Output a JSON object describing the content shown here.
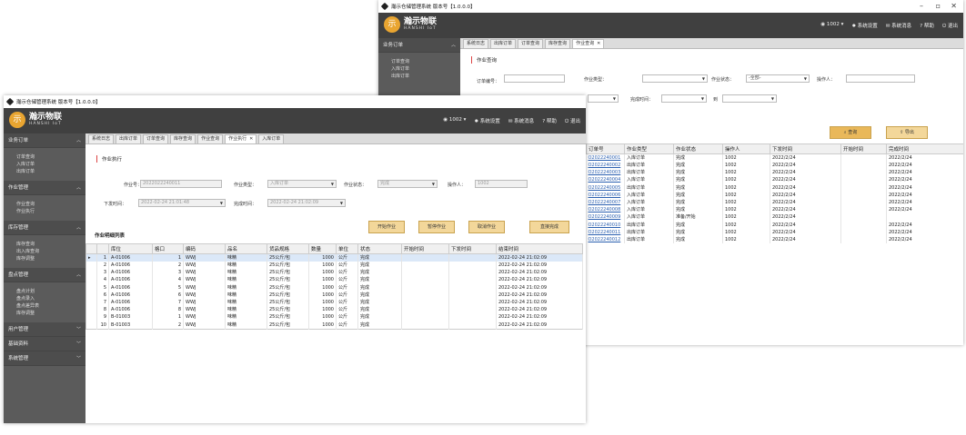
{
  "window_title": "瀚示仓储管理系统 版本号【1.0.0.0】",
  "logo": {
    "char": "示",
    "cn": "瀚示物联",
    "en": "HANSHI IoT"
  },
  "header": {
    "user": "1002",
    "settings": "系统设置",
    "messages": "系统消息",
    "help": "帮助",
    "exit": "退出"
  },
  "controls": {
    "min": "–",
    "max": "▫",
    "close": "✕"
  },
  "back": {
    "sidebar": [
      {
        "group": "业务订单",
        "items": [
          "订单查询",
          "入库订单",
          "出库订单"
        ]
      }
    ],
    "tabs": [
      "系统日志",
      "出库订单",
      "订单查询",
      "库存查询",
      "作业查询"
    ],
    "panel_title": "作业查询",
    "filters": {
      "order_no": "订单编号：",
      "job_type": "作业类型：",
      "job_status": "作业状态：",
      "status_value": "-全部-",
      "operator": "操作人：",
      "finish_time": "完成时间：",
      "to": "到"
    },
    "query": "查询",
    "export": "导出",
    "columns": [
      "订单号",
      "作业类型",
      "作业状态",
      "操作人",
      "下发时间",
      "开始时间",
      "完成时间"
    ],
    "rows": [
      [
        "O2022240001",
        "入库订单",
        "完成",
        "1002",
        "2022/2/24",
        "",
        "2022/2/24"
      ],
      [
        "O2022240002",
        "出库订单",
        "完成",
        "1002",
        "2022/2/24",
        "",
        "2022/2/24"
      ],
      [
        "O2022240003",
        "出库订单",
        "完成",
        "1002",
        "2022/2/24",
        "",
        "2022/2/24"
      ],
      [
        "O2022240004",
        "入库订单",
        "完成",
        "1002",
        "2022/2/24",
        "",
        "2022/2/24"
      ],
      [
        "O2022240005",
        "出库订单",
        "完成",
        "1002",
        "2022/2/24",
        "",
        "2022/2/24"
      ],
      [
        "O2022240006",
        "入库订单",
        "完成",
        "1002",
        "2022/2/24",
        "",
        "2022/2/24"
      ],
      [
        "O2022240007",
        "入库订单",
        "完成",
        "1002",
        "2022/2/24",
        "",
        "2022/2/24"
      ],
      [
        "O2022240008",
        "入库订单",
        "完成",
        "1002",
        "2022/2/24",
        "",
        "2022/2/24"
      ],
      [
        "O2022240009",
        "入库订单",
        "准备/开始",
        "1002",
        "2022/2/24",
        "",
        ""
      ],
      [
        "O2022240010",
        "出库订单",
        "完成",
        "1002",
        "2022/2/24",
        "",
        "2022/2/24"
      ],
      [
        "O2022240011",
        "出库订单",
        "完成",
        "1002",
        "2022/2/24",
        "",
        "2022/2/24"
      ],
      [
        "O2022240012",
        "出库订单",
        "完成",
        "1002",
        "2022/2/24",
        "",
        "2022/2/24"
      ]
    ]
  },
  "front": {
    "sidebar": [
      {
        "group": "业务订单",
        "items": [
          "订单查询",
          "入库订单",
          "出库订单"
        ]
      },
      {
        "group": "作业管理",
        "items": [
          "作业查询",
          "作业执行"
        ]
      },
      {
        "group": "库存管理",
        "items": [
          "库存查询",
          "出入库查询",
          "库存调整"
        ]
      },
      {
        "group": "盘点管理",
        "items": [
          "盘点计划",
          "盘点录入",
          "盘点差异表",
          "库存调整"
        ]
      },
      {
        "group": "用户管理",
        "items": []
      },
      {
        "group": "基础资料",
        "items": []
      },
      {
        "group": "系统管理",
        "items": []
      }
    ],
    "tabs": [
      "系统日志",
      "出库订单",
      "订单查询",
      "库存查询",
      "作业查询",
      "作业执行",
      "入库订单"
    ],
    "active_tab": "作业执行",
    "panel_title": "作业执行",
    "form": {
      "job_no_label": "作业号：",
      "job_no": "2022022240011",
      "job_type_label": "作业类型：",
      "job_type": "入库订单",
      "job_status_label": "作业状态：",
      "job_status": "完成",
      "operator_label": "操作人：",
      "operator": "1002",
      "issue_time_label": "下发时间：",
      "issue_time": "2022-02-24 21:01:48",
      "finish_time_label": "完成时间：",
      "finish_time": "2022-02-24 21:02:09"
    },
    "buttons": [
      "开始作业",
      "暂停作业",
      "取消作业",
      "直接完成"
    ],
    "grid_title": "作业明细列表",
    "columns": [
      "库位",
      "格口",
      "编码",
      "品名",
      "货品规格",
      "数量",
      "单位",
      "状态",
      "开始时间",
      "下发时间",
      "结束时间"
    ],
    "rows": [
      [
        "1",
        "A-01006",
        "1",
        "WWJ",
        "味精",
        "25公斤/包",
        "1000",
        "公斤",
        "完成",
        "",
        "",
        "2022-02-24 21:02:09"
      ],
      [
        "2",
        "A-01006",
        "2",
        "WWJ",
        "味精",
        "25公斤/包",
        "1000",
        "公斤",
        "完成",
        "",
        "",
        "2022-02-24 21:02:09"
      ],
      [
        "3",
        "A-01006",
        "3",
        "WWJ",
        "味精",
        "25公斤/包",
        "1000",
        "公斤",
        "完成",
        "",
        "",
        "2022-02-24 21:02:09"
      ],
      [
        "4",
        "A-01006",
        "4",
        "WWJ",
        "味精",
        "25公斤/包",
        "1000",
        "公斤",
        "完成",
        "",
        "",
        "2022-02-24 21:02:09"
      ],
      [
        "5",
        "A-01006",
        "5",
        "WWJ",
        "味精",
        "25公斤/包",
        "1000",
        "公斤",
        "完成",
        "",
        "",
        "2022-02-24 21:02:09"
      ],
      [
        "6",
        "A-01006",
        "6",
        "WWJ",
        "味精",
        "25公斤/包",
        "1000",
        "公斤",
        "完成",
        "",
        "",
        "2022-02-24 21:02:09"
      ],
      [
        "7",
        "A-01006",
        "7",
        "WWJ",
        "味精",
        "25公斤/包",
        "1000",
        "公斤",
        "完成",
        "",
        "",
        "2022-02-24 21:02:09"
      ],
      [
        "8",
        "A-01006",
        "8",
        "WWJ",
        "味精",
        "25公斤/包",
        "1000",
        "公斤",
        "完成",
        "",
        "",
        "2022-02-24 21:02:09"
      ],
      [
        "9",
        "B-01003",
        "1",
        "WWJ",
        "味精",
        "25公斤/包",
        "1000",
        "公斤",
        "完成",
        "",
        "",
        "2022-02-24 21:02:09"
      ],
      [
        "10",
        "B-01003",
        "2",
        "WWJ",
        "味精",
        "25公斤/包",
        "1000",
        "公斤",
        "完成",
        "",
        "",
        "2022-02-24 21:02:09"
      ]
    ]
  }
}
